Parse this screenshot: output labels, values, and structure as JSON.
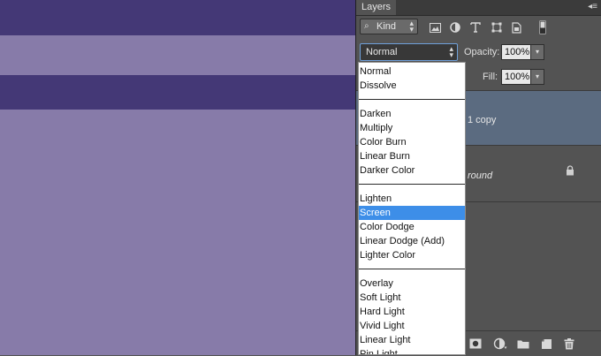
{
  "canvas": {
    "bg_color": "#877ba9",
    "band_color": "#443876"
  },
  "panel": {
    "tab_label": "Layers",
    "menu_icon": "panel-menu-icon",
    "filter": {
      "kind_label": "Kind",
      "icons": [
        "pixel-filter-icon",
        "adjustment-filter-icon",
        "type-filter-icon",
        "shape-filter-icon",
        "smart-object-filter-icon",
        "filter-toggle-icon"
      ]
    },
    "blend": {
      "current": "Normal",
      "opacity_label": "Opacity:",
      "opacity_value": "100%",
      "fill_label": "Fill:",
      "fill_value": "100%"
    },
    "layers": [
      {
        "name": "1 copy",
        "selected": true
      },
      {
        "name": "round",
        "selected": false,
        "locked": true
      }
    ],
    "bottom_icons": [
      "add-mask-icon",
      "adjustment-layer-icon",
      "new-group-icon",
      "new-layer-icon",
      "delete-layer-icon"
    ]
  },
  "dropdown": {
    "groups": [
      [
        "Normal",
        "Dissolve"
      ],
      [
        "Darken",
        "Multiply",
        "Color Burn",
        "Linear Burn",
        "Darker Color"
      ],
      [
        "Lighten",
        "Screen",
        "Color Dodge",
        "Linear Dodge (Add)",
        "Lighter Color"
      ],
      [
        "Overlay",
        "Soft Light",
        "Hard Light",
        "Vivid Light",
        "Linear Light",
        "Pin Light"
      ]
    ],
    "highlighted": "Screen",
    "highlight_color": "#3d8ee8"
  }
}
